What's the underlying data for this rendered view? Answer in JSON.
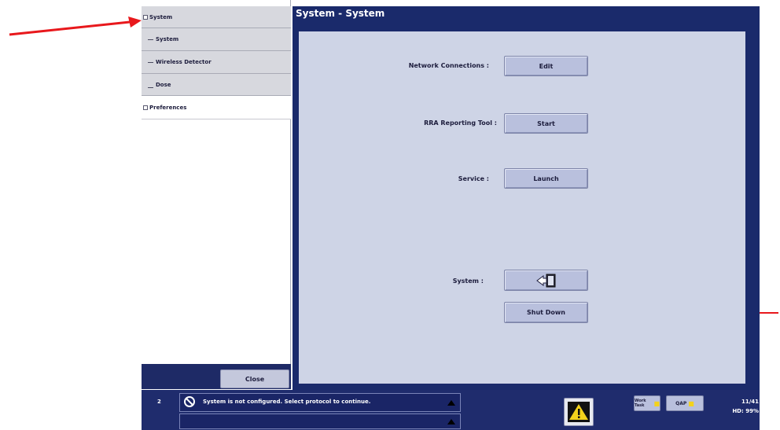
{
  "tree": {
    "root_label": "System",
    "children": [
      "System",
      "Wireless Detector",
      "Dose"
    ],
    "preferences_label": "Preferences",
    "close_label": "Close"
  },
  "main": {
    "title": "System - System",
    "rows": [
      {
        "label": "Network Connections :",
        "button": "Edit"
      },
      {
        "label": "RRA Reporting Tool :",
        "button": "Start"
      },
      {
        "label": "Service :",
        "button": "Launch"
      },
      {
        "label": "System :",
        "button_icon": "logout-door-icon"
      }
    ],
    "shutdown_label": "Shut Down"
  },
  "status": {
    "index": "2",
    "message": "System is not configured. Select protocol to continue.",
    "button1_label": "Work Task",
    "button2_label": "QAP",
    "time": "11/41",
    "hd_usage": "HD: 99%"
  },
  "colors": {
    "annotation_arrow": "#e8181c",
    "header_bg": "#1a2a6b",
    "panel_bg": "#ced4e6"
  }
}
